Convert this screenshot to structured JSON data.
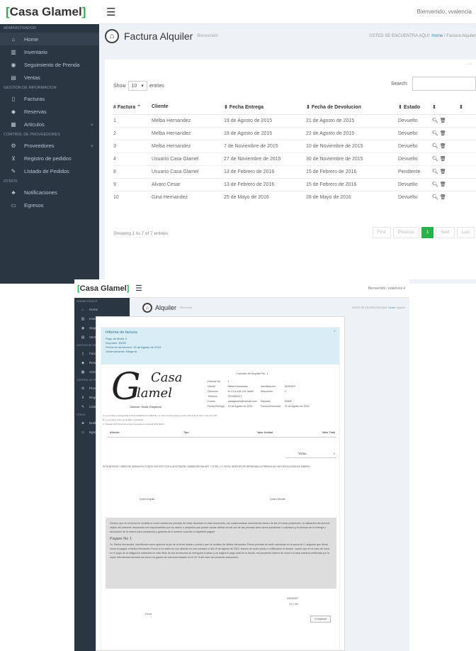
{
  "brand": {
    "bracket_left": "[",
    "name": "Casa Glamel",
    "bracket_right": "]"
  },
  "header": {
    "welcome": "Bienvenido, vvalencia",
    "welcome_dropdown": "Bienvenido, vvalencia ▾"
  },
  "sidebar": {
    "sections": [
      {
        "title": "ADMINISTRADOR",
        "items": [
          {
            "label": "Home",
            "icon": "home-icon"
          },
          {
            "label": "Inventario",
            "icon": "building-icon"
          },
          {
            "label": "Seguimiento de Prenda",
            "icon": "eye-icon"
          },
          {
            "label": "Ventas",
            "icon": "chart-icon"
          }
        ]
      },
      {
        "title": "GESTION DE INFORMACION",
        "items": [
          {
            "label": "Facturas",
            "icon": "file-icon"
          },
          {
            "label": "Reservas",
            "icon": "diamond-icon"
          },
          {
            "label": "Articulos",
            "icon": "list-icon"
          }
        ]
      },
      {
        "title": "CONTROL DE PROVEEDORES",
        "items": [
          {
            "label": "Proveedores",
            "icon": "cogs-icon"
          },
          {
            "label": "Registro de pedidos",
            "icon": "cart-icon"
          },
          {
            "label": "Listado de Pedidos",
            "icon": "edit-icon"
          }
        ]
      },
      {
        "title": "OTROS",
        "items": [
          {
            "label": "Notificaciones",
            "icon": "bell-icon"
          },
          {
            "label": "Egresos",
            "icon": "card-icon"
          }
        ]
      }
    ]
  },
  "page1": {
    "title": "Factura Alquiler",
    "subtitle": "Bienvenido",
    "bc_prefix": "USTED SE ENCUENTRA AQUI:",
    "bc_home": "Home",
    "bc_sep": "/",
    "bc_current": "Factura Alquiler",
    "panel_tools": "– ×",
    "show": "Show",
    "entries_value": "10",
    "entries": "entries",
    "search": "Search:",
    "columns": [
      "# Factura",
      "Cliente",
      "Fecha Entrega",
      "Fecha de Devolucion",
      "Estado"
    ],
    "rows": [
      [
        "1",
        "Melba Hernandez",
        "19 de Agosto de 2015",
        "21 de Agosto de 2015",
        "Devuelto"
      ],
      [
        "2",
        "Melba Hernandez",
        "18 de Agosto de 2015",
        "22 de Agosto de 2015",
        "Devuelto"
      ],
      [
        "3",
        "Melba Hernandez",
        "7 de Noviembre de 2015",
        "10 de Noviembre de 2015",
        "Devuelto"
      ],
      [
        "4",
        "Usuario Casa Glamel",
        "27 de Noviembre de 2015",
        "30 de Noviembre de 2015",
        "Devuelto"
      ],
      [
        "8",
        "Usuario Casa Glamel",
        "13 de Febrero de 2016",
        "15 de Febrero de 2016",
        "Pendiente"
      ],
      [
        "9",
        "Alvaro Cesar",
        "13 de Febrero de 2016",
        "15 de Febrero de 2016",
        "Devuelto"
      ],
      [
        "10",
        "Gina Hernandez",
        "25 de Mayo de 2016",
        "28 de Mayo de 2016",
        "Devuelto"
      ]
    ],
    "showing": "Showing 1 to 7 of 7 entries",
    "pager": [
      "First",
      "Previous",
      "1",
      "Next",
      "Last"
    ]
  },
  "page2": {
    "title": "Alquiler",
    "subtitle": "Bienvenido",
    "bc_prefix": "USTED SE ENCUENTRA AQUI:",
    "bc_home": "Home",
    "bc_sep": "/",
    "bc_current": "Alquiler",
    "alert": {
      "heading": "Informe de factura",
      "lines": [
        "Pago de Multa: 0",
        "Deposito: 10000",
        "Fecha de devolucion: 18 de Agosto de 2015",
        "Observaciones: Ninguna"
      ]
    },
    "logo_word1": "Casa",
    "logo_word2": "lamel",
    "logo_initial": "G",
    "logo_tag": "Glamour, Moda, Elegancia",
    "contract": "Contrato de Alquiler No. 1",
    "fields": [
      [
        "Factura No.",
        "1",
        "",
        ""
      ],
      [
        "Cliente",
        "Melba Hernandez",
        "Identificacion.",
        "34940907"
      ],
      [
        "Direccion",
        "Kr 21 A #15-115 Jardin",
        "Descuento",
        "0"
      ],
      [
        "Telefono",
        "3015656217",
        "",
        ""
      ],
      [
        "Correo",
        "casaglamel@hotmail.com",
        "Deposito",
        "10000"
      ],
      [
        "Fecha Entrega",
        "19 de Agosto de 2015",
        "Fecha Devolucion",
        "21 de Agosto de 2015"
      ]
    ],
    "notes": [
      "A. La prenda se entrega bajo la responsabilidad de CLIENTE y en caso presente pagar el valor total de la prenda en caso de daño",
      "B. La prenda se debe ser lavada ni planchada",
      "C. Pasados la 24 horas de retraso la prenda se cobrara $ 2000 diarios"
    ],
    "cols": [
      "Articulo",
      "Tipo",
      "Valor Unidad",
      "Valor Total"
    ],
    "total_label": "TOTAL:",
    "total_value": "0",
    "legal": "ESTA NOTA DE COBRO SE ASIMILA EN TODOS SUS EFECTOS A LA LETRA DE CAMBIO SEGUN ART. 774 DEL C.C NOTA: DESPUES DE SEPARADA LA PRENDA NO HAY DEVOLUCION DE DINERO",
    "sign_left": "Quien Alquila",
    "sign_right": "Quien Recibe",
    "declaration": "Declaro que en la fecha he recibido en buen estado las prendas de vestir descritas en este documento, las cuales estaran devolviendo dentro de las 24 horas posteriores, la utilizacion del servicio objeto del presente documento me responsabilizo por los danos o perjuicios que pueda causar debido al mal uso de las prendas tanto forma accidental o voluntario y la demora de la entrega o devolucion de la misma para constancia y garantia de lo anterior suscribo el siguiente pagare",
    "pagare_title": "Pagare No 1",
    "pagare": "Yo, Melba Hernandez, identificado como aparece al pie de la firma declaro: primero que he recibido de Melba Hernandez Flores prendas de vestir valoradas en la suma de 0, segundo que dicha suma la pagare a Melba Hernandez Flores a su orden en sus oficinas en solo contado el dia 19 de Agosto de 2015 -tercero de aviso previo o notificacion el deudor -cuarto que en el caso de mora en el pago de la obligacion contenida en este titulo de sus accesorios se extinguira el plazo y se exigira el pago total de la deuda, reconociendo interes de mora a la tasa maxima certificada por la super intendencia bancaria asi como los gastos de cobranza basado en el 20 % del valor del presente documento",
    "sig_id": "34940907",
    "sig_cc": "CC / Nit",
    "firma": "Firma",
    "print": "Imprimir"
  }
}
